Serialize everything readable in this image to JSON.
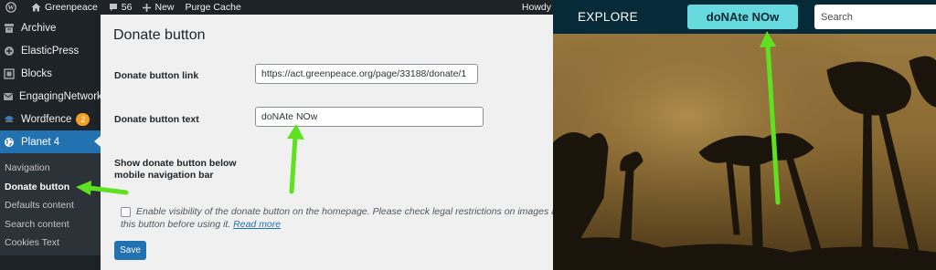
{
  "adminbar": {
    "site_name": "Greenpeace",
    "comments_count": "56",
    "new_label": "New",
    "purge_label": "Purge Cache",
    "howdy": "Howdy"
  },
  "sidebar": {
    "items": [
      {
        "label": "Archive",
        "icon": "archive-icon"
      },
      {
        "label": "ElasticPress",
        "icon": "elasticpress-icon"
      },
      {
        "label": "Blocks",
        "icon": "blocks-icon"
      },
      {
        "label": "EngagingNetworks",
        "icon": "engagingnetworks-icon"
      },
      {
        "label": "Wordfence",
        "icon": "wordfence-icon",
        "badge": "2"
      },
      {
        "label": "Planet 4",
        "icon": "globe-icon",
        "active": true
      }
    ],
    "submenu": [
      {
        "label": "Navigation"
      },
      {
        "label": "Donate button",
        "current": true
      },
      {
        "label": "Defaults content"
      },
      {
        "label": "Search content"
      },
      {
        "label": "Cookies Text"
      }
    ]
  },
  "main": {
    "title": "Donate button",
    "link_label": "Donate button link",
    "link_value": "https://act.greenpeace.org/page/33188/donate/1",
    "text_label": "Donate button text",
    "text_value": "doNAte NOw",
    "show_label_line1": "Show donate button below",
    "show_label_line2": "mobile navigation bar",
    "checkbox_text_line1": "Enable visibility of the donate button on the homepage. Please check legal restrictions on images ass",
    "checkbox_text_line2": "this button before using it.",
    "read_more": "Read more",
    "save_label": "Save"
  },
  "site": {
    "explore_label": "EXPLORE",
    "donate_label": "doNAte NOw",
    "search_placeholder": "Search"
  },
  "colors": {
    "wp_dark": "#1d2327",
    "wp_blue": "#2271b1",
    "site_nav": "#072a39",
    "donate_teal": "#66dadf",
    "arrow_green": "#5ee21f"
  }
}
